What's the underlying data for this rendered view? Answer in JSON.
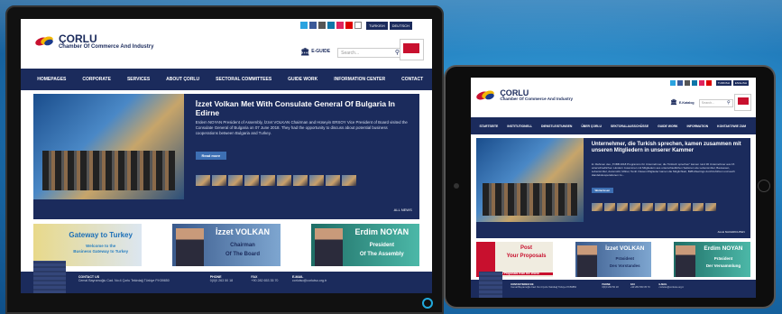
{
  "desktop": {
    "title_line1": "ÇORLU",
    "title_line2": "Chamber Of Commerce And Industry",
    "lang": [
      "TURKISH",
      "DEUTSCH"
    ],
    "eguide": "E-GUIDE",
    "search_placeholder": "Search...",
    "nav": [
      "HOMEPAGES",
      "CORPORATE",
      "SERVICES",
      "ABOUT ÇORLU",
      "SECTORAL COMMITTEES",
      "GUIDE WORK",
      "INFORMATION CENTER",
      "CONTACT"
    ],
    "headline": "İzzet Volkan Met With Consulate General Of Bulgaria In Edirne",
    "body": "Erdem NOYAN President of Assembly, İzzet VOLKAN Chairman and Hüseyin ERSOY Vice President of Board visited the Consulate General of Bulgaria on 07 June 2018. They had the opportunity to discuss about potential business cooperations between Bulgaria and Turkey.",
    "read_more": "Read more",
    "all_news": "ALL NEWS",
    "banner1": [
      "Gateway to Turkey",
      "Welcome to the",
      "Business Gateway to Turkey"
    ],
    "banner2": [
      "İzzet VOLKAN",
      "Chairman",
      "Of The Board"
    ],
    "banner3": [
      "Erdim NOYAN",
      "President",
      "Of The Assembly"
    ],
    "footer": [
      {
        "h": "CONTACT US",
        "v": "Cemal Bayramoğlu Cad. No:4 Çorlu Tekirdağ Türkiye P.K59850"
      },
      {
        "h": "PHONE",
        "v": "0(0)0 263 50 18"
      },
      {
        "h": "FAX",
        "v": "+90 282 653 35 70"
      },
      {
        "h": "E-MAIL",
        "v": "corlutso@corlutso.org.tr"
      }
    ]
  },
  "tablet": {
    "title_line1": "ÇORLU",
    "title_line2": "Chamber Of Commerce And Industry",
    "lang": [
      "TURKISH",
      "ENGLISH"
    ],
    "eguide": "E-Katalog",
    "search_placeholder": "Search...",
    "nav": [
      "STARTSEITE",
      "INSTITUTIONELL",
      "DIENSTLEISTUNGEN",
      "ÜBER ÇORLU",
      "SEKTORALAUSSCHÜSSE",
      "GUIDE WORK",
      "INFORMATION",
      "KONTAKT/WIE ZUM"
    ],
    "headline": "Unternehmer, die Turkish sprechen, kamen zusammen mit unseren Mitgliedern in unserer Kammer",
    "body": "Im Rahmen des „TOBB 2018 Programms für Unternehmer, die Türkisch sprechen\" kamen rund 30 Unternehmer aus 15 unterschiedlichen Ländern zusammen mit Mitgliedern aus unterschiedlichen Sektoren wie Lebensmittel, Bauwesen, Lebensmittel, Automobil, Möbel, Textil. Dieses Mitglieder kamen die Möglichkeit, B2B-Meetings durchzuführen und auch Handelskooperationen zu...",
    "read_more": "Weiterlesen",
    "all_news": "ALLE NACHRICHTEN",
    "banner1": [
      "Post",
      "Your Proposals",
      "Business Proposals from the World"
    ],
    "banner2": [
      "İzzet VOLKAN",
      "Präsident",
      "Des Vorstandes"
    ],
    "banner3": [
      "Erdim NOYAN",
      "Präsident",
      "Der Versammlung"
    ],
    "footer": [
      {
        "h": "KONTAKTIEREN SIE",
        "v": "Cemal Bayramoğlu Cad. No:4 Çorlu Tekirdağ Türkiye P.K59850"
      },
      {
        "h": "PHONE",
        "v": "0(0)0 263 50 18"
      },
      {
        "h": "FAX",
        "v": "+90 282 653 35 70"
      },
      {
        "h": "E-MAIL",
        "v": "corlutso@corlutso.org.tr"
      }
    ]
  },
  "colors": {
    "navy": "#1b2b5c",
    "accent": "#2a7fc0",
    "red": "#c8102e",
    "teal": "#2a9c8c"
  }
}
